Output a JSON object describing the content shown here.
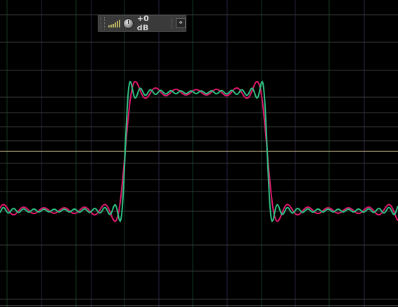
{
  "hud": {
    "gain_label": "+0 dB",
    "pin_glyph": "⌖",
    "icons": [
      "grip-icon",
      "volume-meter-icon",
      "volume-knob-icon",
      "pin-icon"
    ]
  },
  "view": {
    "background": "#000000",
    "grid_major_color": "#3a3a3a",
    "grid_vertical_color": "#0f3a22",
    "grid_horizontal_color": "#3a1e3a",
    "centerline_color": "#e8d7a0",
    "baseline_color": "#6a6a6a"
  },
  "waveforms": [
    {
      "name": "magenta",
      "color": "#e0186e",
      "harmonics": 13,
      "amp_scale": 1.0
    },
    {
      "name": "green",
      "color": "#2fbf82",
      "harmonics": 27,
      "amp_scale": 1.0
    }
  ]
}
